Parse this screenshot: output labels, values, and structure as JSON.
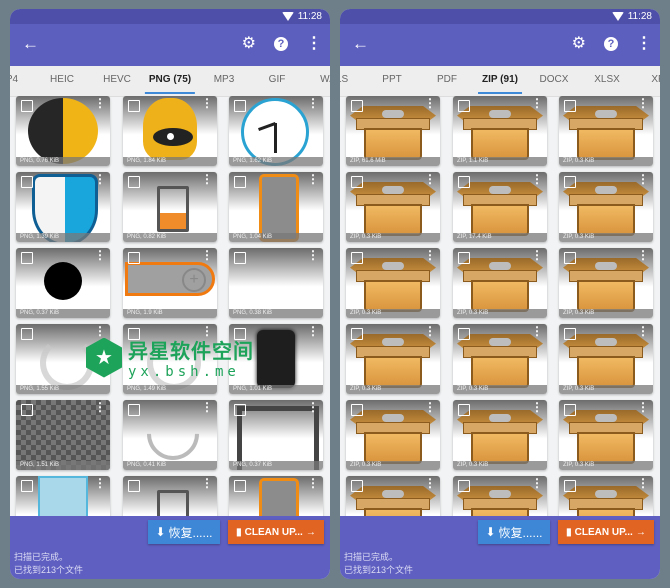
{
  "status_bar": {
    "time": "11:28"
  },
  "app_bar": {
    "back_icon": "arrow-left-icon",
    "settings_icon": "gear-icon",
    "help_icon": "help-circle-icon",
    "help_glyph": "?",
    "more_icon": "more-vertical-icon"
  },
  "left": {
    "tabs": [
      {
        "label": "P4",
        "active": false
      },
      {
        "label": "HEIC",
        "active": false
      },
      {
        "label": "HEVC",
        "active": false
      },
      {
        "label": "PNG (75)",
        "active": true
      },
      {
        "label": "MP3",
        "active": false
      },
      {
        "label": "GIF",
        "active": false
      },
      {
        "label": "WA",
        "active": false
      }
    ],
    "tiles": [
      {
        "label": "PNG, 0.76 KiB",
        "art": "half-circle"
      },
      {
        "label": "PNG, 1.84 KiB",
        "art": "bell"
      },
      {
        "label": "PNG, 1.62 KiB",
        "art": "clock"
      },
      {
        "label": "PNG, 1.39 KiB",
        "art": "shield"
      },
      {
        "label": "PNG, 0.82 KiB",
        "art": "battery"
      },
      {
        "label": "PNG, 1.04 KiB",
        "art": "phone-orange"
      },
      {
        "label": "PNG, 0.37 KiB",
        "art": "black-dot"
      },
      {
        "label": "PNG, 1.9 KiB",
        "art": "pill-add"
      },
      {
        "label": "PNG, 0.38 KiB",
        "art": "blank"
      },
      {
        "label": "PNG, 1.55 KiB",
        "art": "refresh"
      },
      {
        "label": "PNG, 1.49 KiB",
        "art": "refresh"
      },
      {
        "label": "PNG, 1.01 KiB",
        "art": "phone-dark"
      },
      {
        "label": "PNG, 1.51 KiB",
        "art": "checker"
      },
      {
        "label": "PNG, 0.41 KiB",
        "art": "arc"
      },
      {
        "label": "PNG, 0.37 KiB",
        "art": "frame"
      },
      {
        "label": "",
        "art": "blue-panel"
      },
      {
        "label": "",
        "art": "battery"
      },
      {
        "label": "",
        "art": "phone-orange"
      }
    ]
  },
  "right": {
    "tabs": [
      {
        "label": "LS",
        "active": false
      },
      {
        "label": "PPT",
        "active": false
      },
      {
        "label": "PDF",
        "active": false
      },
      {
        "label": "ZIP (91)",
        "active": true
      },
      {
        "label": "DOCX",
        "active": false
      },
      {
        "label": "XLSX",
        "active": false
      },
      {
        "label": "XP",
        "active": false
      }
    ],
    "tiles": [
      {
        "label": "ZIP, 61.6 MiB"
      },
      {
        "label": "ZIP, 1.1 KiB"
      },
      {
        "label": "ZIP, 0.3 KiB"
      },
      {
        "label": "ZIP, 0.3 KiB"
      },
      {
        "label": "ZIP, 17.4 KiB"
      },
      {
        "label": "ZIP, 0.3 KiB"
      },
      {
        "label": "ZIP, 0.3 KiB"
      },
      {
        "label": "ZIP, 0.3 KiB"
      },
      {
        "label": "ZIP, 0.3 KiB"
      },
      {
        "label": "ZIP, 0.3 KiB"
      },
      {
        "label": "ZIP, 0.3 KiB"
      },
      {
        "label": "ZIP, 0.3 KiB"
      },
      {
        "label": "ZIP, 0.3 KiB"
      },
      {
        "label": "ZIP, 0.3 KiB"
      },
      {
        "label": "ZIP, 0.3 KiB"
      },
      {
        "label": ""
      },
      {
        "label": ""
      },
      {
        "label": ""
      }
    ]
  },
  "bottom": {
    "restore_label": "恢复......",
    "restore_icon": "download-icon",
    "clean_label": "CLEAN UP...",
    "clean_icon": "trash-icon",
    "clean_arrow_icon": "arrow-right-icon",
    "status_line1": "扫描已完成。",
    "status_line2": "已找到213个文件"
  },
  "watermark": {
    "title": "异星软件空间",
    "url": "yx.bsh.me",
    "color": "#1ea35a"
  },
  "colors": {
    "status_bar": "#4e4fa8",
    "app_bar": "#5d5fbf",
    "tab_indicator": "#3f8ad8",
    "restore_button": "#3e87d6",
    "clean_button": "#e26422"
  }
}
